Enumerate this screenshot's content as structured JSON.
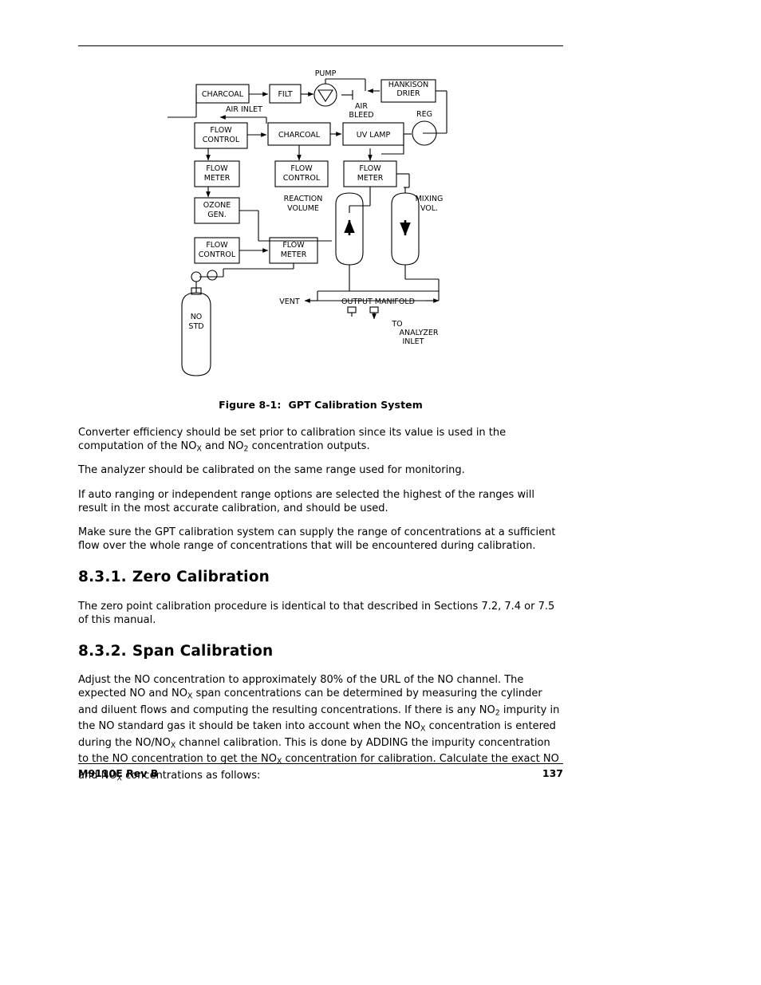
{
  "figure": {
    "caption_label": "Figure 8-1:",
    "caption_title": "GPT Calibration System",
    "labels": {
      "charcoal_1": "CHARCOAL",
      "filt": "FILT",
      "pump": "PUMP",
      "air_bleed_line1": "AIR",
      "air_bleed_line2": "BLEED",
      "hankison_line1": "HANKISON",
      "hankison_line2": "DRIER",
      "air_inlet": "AIR  INLET",
      "flow_control_1_line1": "FLOW",
      "flow_control_1_line2": "CONTROL",
      "charcoal_2": "CHARCOAL",
      "uv_lamp": "UV  LAMP",
      "reg": "REG",
      "flow_meter_1_line1": "FLOW",
      "flow_meter_1_line2": "METER",
      "flow_control_2_line1": "FLOW",
      "flow_control_2_line2": "CONTROL",
      "flow_meter_2_line1": "FLOW",
      "flow_meter_2_line2": "METER",
      "reaction_volume_line1": "REACTION",
      "reaction_volume_line2": "VOLUME",
      "mixing_vol_line1": "MIXING",
      "mixing_vol_line2": "VOL.",
      "ozone_gen_line1": "OZONE",
      "ozone_gen_line2": "GEN.",
      "flow_control_3_line1": "FLOW",
      "flow_control_3_line2": "CONTROL",
      "flow_meter_3_line1": "FLOW",
      "flow_meter_3_line2": "METER",
      "no_std_line1": "NO",
      "no_std_line2": "STD",
      "vent": "VENT",
      "output_manifold": "OUTPUT  MANIFOLD",
      "to_analyzer_line1": "TO",
      "to_analyzer_line2": "ANALYZER",
      "to_analyzer_line3": "INLET"
    }
  },
  "paragraphs": {
    "p1_a": "Converter efficiency should be set prior to calibration since its value is used in the computation of the NO",
    "p1_sub1": "X",
    "p1_b": " and NO",
    "p1_sub2": "2",
    "p1_c": " concentration outputs.",
    "p2": "The analyzer should be calibrated on the same range used for monitoring.",
    "p3": "If auto ranging or independent range options are selected the highest of the ranges will result in the most accurate calibration, and should be used.",
    "p4": "Make sure the GPT calibration system can supply the range of concentrations at a sufficient flow over the whole range of concentrations that will be encountered during calibration."
  },
  "sections": {
    "zero": {
      "number": "8.3.1.",
      "title": "Zero Calibration",
      "body": "The zero point calibration procedure is identical to that described in Sections 7.2, 7.4 or 7.5 of this manual."
    },
    "span": {
      "number": "8.3.2.",
      "title": "Span Calibration",
      "body_a": "Adjust the NO concentration to approximately 80% of the URL of the NO channel. The expected NO and NO",
      "sub_x1": "X",
      "body_b": " span concentrations can be determined by measuring the cylinder and diluent flows and computing the resulting concentrations. If there is any NO",
      "sub_2": "2",
      "body_c": " impurity in the NO standard gas it should be taken into account when the NO",
      "sub_x2": "X",
      "body_d": " concentration is entered during the NO/NO",
      "sub_x3": "X",
      "body_e": " channel calibration. This is done by ADDING the impurity concentration to the NO concentration to get the NO",
      "sub_x4": "X",
      "body_f": " concentration for calibration. Calculate the exact NO and NO",
      "sub_x5": "X",
      "body_g": " concentrations as follows:"
    }
  },
  "footer": {
    "left": "M9110E Rev B",
    "page_number": "137"
  }
}
